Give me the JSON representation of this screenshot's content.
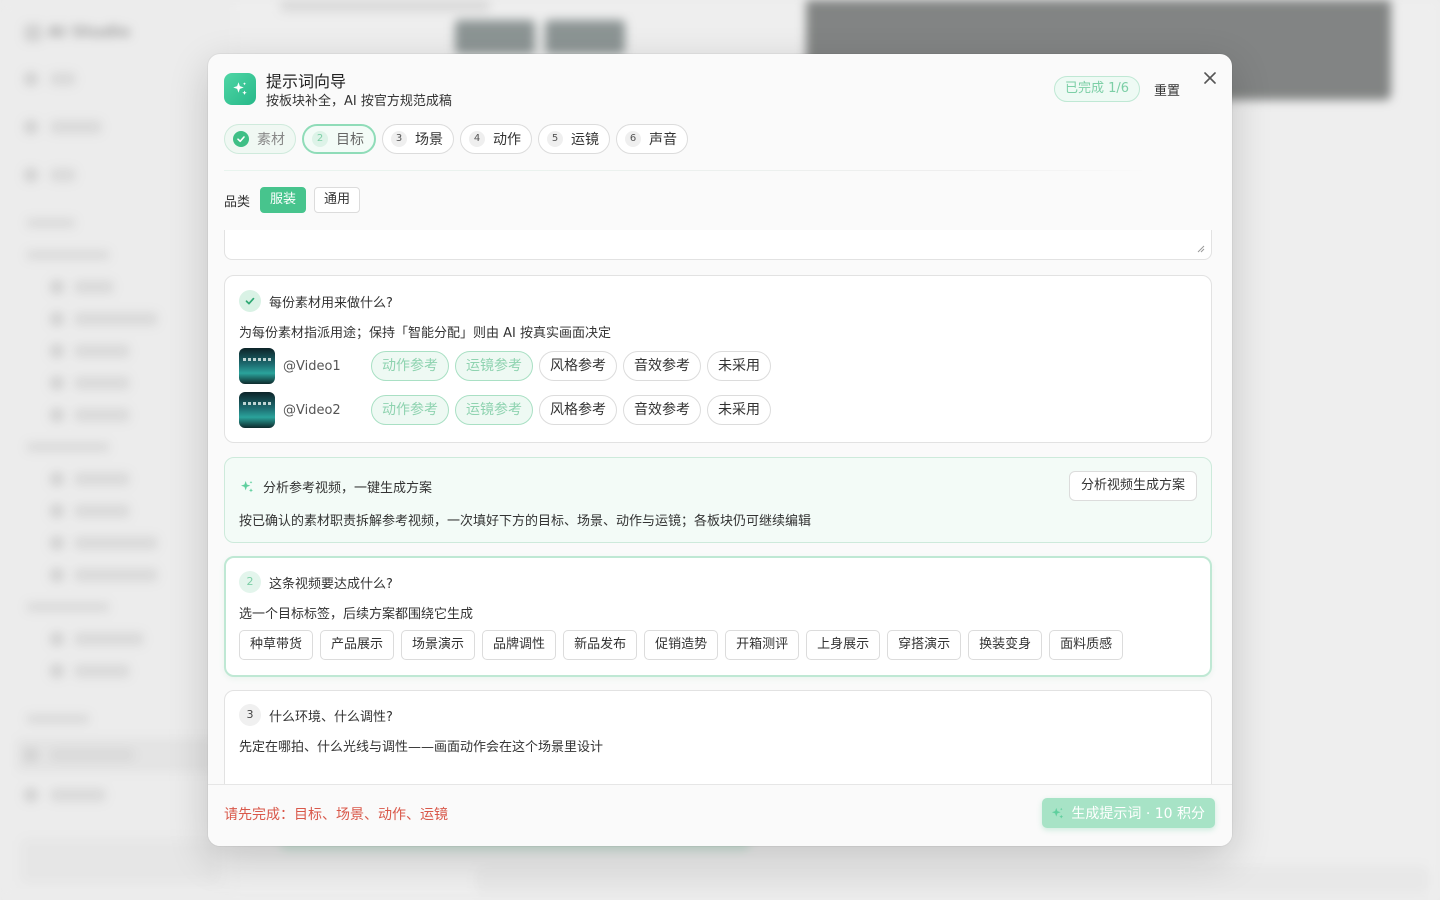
{
  "background": {
    "brand": "AI Studio"
  },
  "modal": {
    "title": "提示词向导",
    "subtitle": "按板块补全，AI 按官方规范成稿",
    "progress": "已完成 1/6",
    "reset_label": "重置",
    "steps": [
      {
        "num": "",
        "label": "素材",
        "state": "done"
      },
      {
        "num": "2",
        "label": "目标",
        "state": "current"
      },
      {
        "num": "3",
        "label": "场景",
        "state": "todo"
      },
      {
        "num": "4",
        "label": "动作",
        "state": "todo"
      },
      {
        "num": "5",
        "label": "运镜",
        "state": "todo"
      },
      {
        "num": "6",
        "label": "声音",
        "state": "todo"
      }
    ],
    "category": {
      "label": "品类",
      "options": [
        "服装",
        "通用"
      ],
      "selected": "服装"
    },
    "assets_card": {
      "title": "每份素材用来做什么?",
      "description": "为每份素材指派用途；保持「智能分配」则由 AI 按真实画面决定",
      "role_options": [
        "动作参考",
        "运镜参考",
        "风格参考",
        "音效参考",
        "未采用"
      ],
      "assets": [
        {
          "name": "@Video1",
          "selected_roles": [
            "动作参考",
            "运镜参考"
          ]
        },
        {
          "name": "@Video2",
          "selected_roles": [
            "动作参考",
            "运镜参考"
          ]
        }
      ]
    },
    "analyze_card": {
      "title": "分析参考视频，一键生成方案",
      "description": "按已确认的素材职责拆解参考视频，一次填好下方的目标、场景、动作与运镜；各板块仍可继续编辑",
      "button_label": "分析视频生成方案"
    },
    "goal_card": {
      "num": "2",
      "title": "这条视频要达成什么?",
      "description": "选一个目标标签，后续方案都围绕它生成",
      "tags": [
        "种草带货",
        "产品展示",
        "场景演示",
        "品牌调性",
        "新品发布",
        "促销造势",
        "开箱测评",
        "上身展示",
        "穿搭演示",
        "换装变身",
        "面料质感"
      ]
    },
    "scene_card": {
      "num": "3",
      "title": "什么环境、什么调性?",
      "description": "先定在哪拍、什么光线与调性——画面动作会在这个场景里设计"
    },
    "footer": {
      "warning": "请先完成：目标、场景、动作、运镜",
      "generate_label": "生成提示词 · 10 积分"
    }
  },
  "colors": {
    "accent": "#47c48d",
    "accent_light": "#a7e3c6",
    "warning": "#d9584a"
  },
  "icons": {
    "logo": "sparkle-icon",
    "close": "close-icon",
    "done_step": "check-icon"
  }
}
